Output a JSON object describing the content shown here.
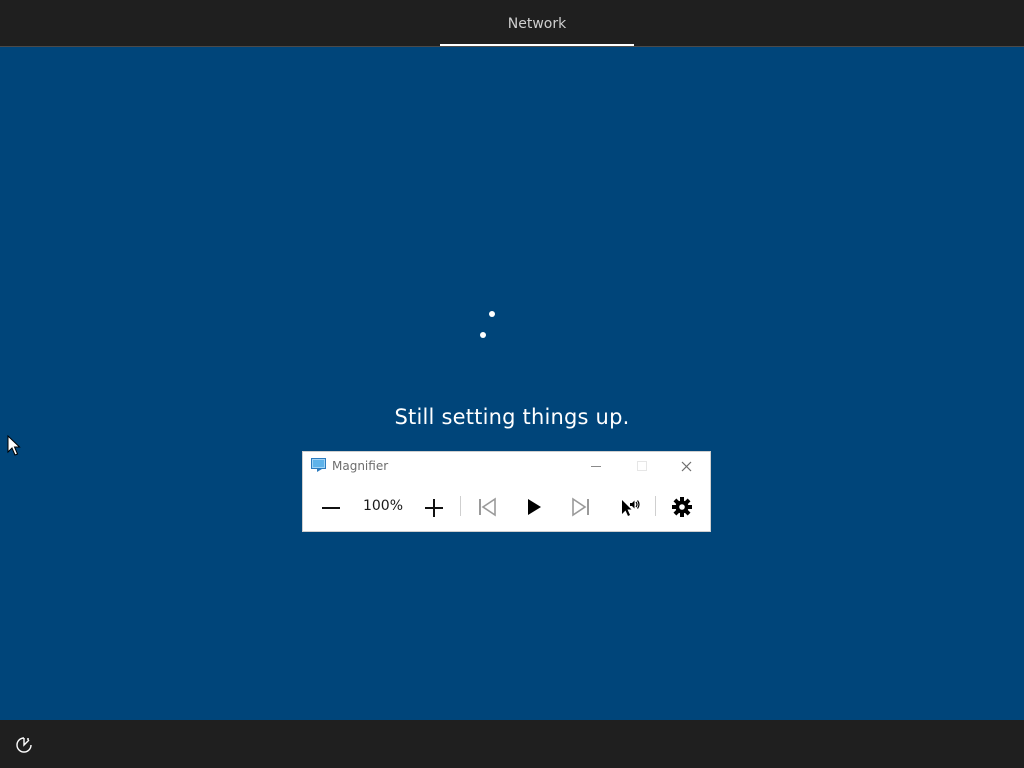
{
  "header": {
    "tab_label": "Network"
  },
  "main": {
    "status_text": "Still setting things up."
  },
  "magnifier": {
    "title": "Magnifier",
    "zoom_level": "100%",
    "controls": {
      "zoom_out": "minus-icon",
      "zoom_in": "plus-icon",
      "previous": "previous-track-icon",
      "play": "play-icon",
      "next": "next-track-icon",
      "read_from_pointer": "read-from-pointer-icon",
      "settings": "gear-icon"
    },
    "window_buttons": [
      "minimize-icon",
      "maximize-icon",
      "close-icon"
    ]
  },
  "footer": {
    "ease_of_access_icon": "ease-of-access-icon"
  },
  "colors": {
    "background": "#00457a",
    "bars": "#1f1f1f",
    "text": "#ffffff"
  }
}
